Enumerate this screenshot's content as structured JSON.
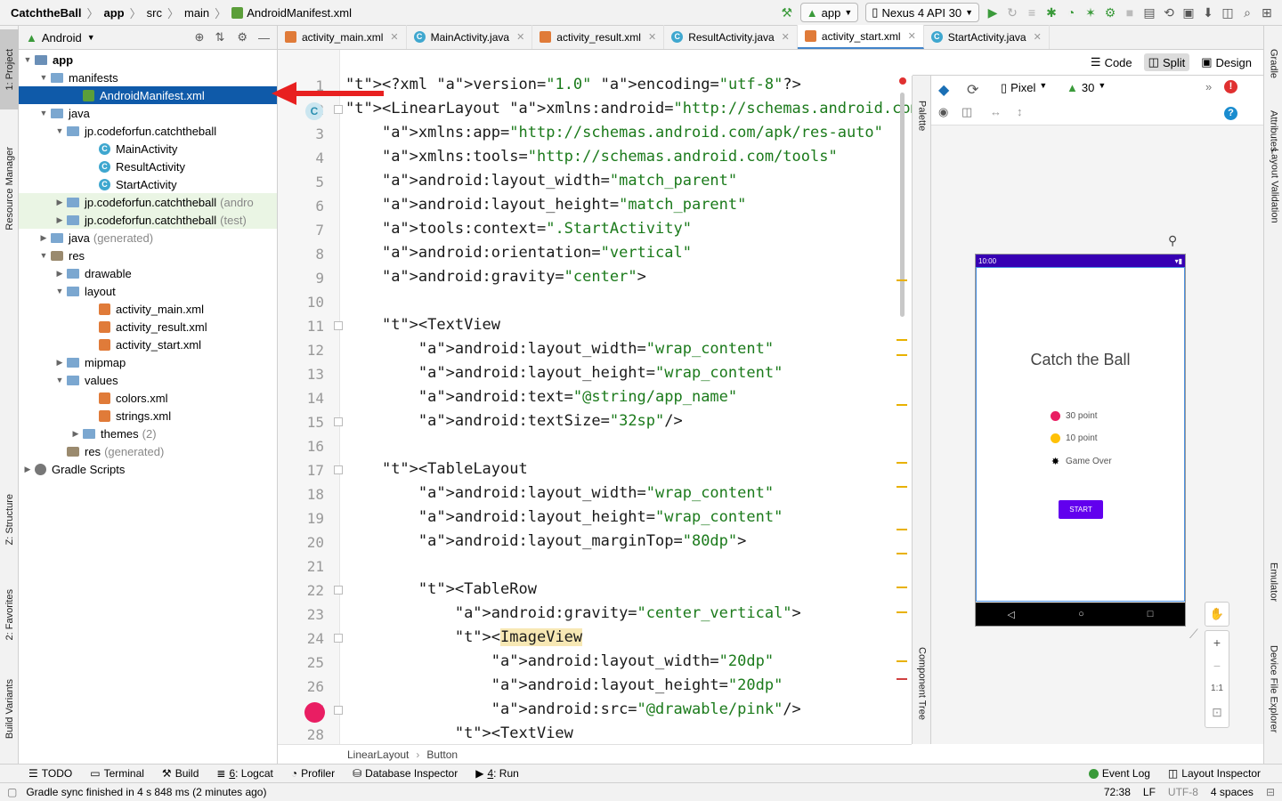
{
  "navbar": {
    "crumbs": [
      "CatchtheBall",
      "app",
      "src",
      "main",
      "AndroidManifest.xml"
    ],
    "run_config": "app",
    "device": "Nexus 4 API 30"
  },
  "left_strip": {
    "project_tab": "1: Project",
    "resource_tab": "Resource Manager",
    "structure_tab": "Z: Structure",
    "favorites_tab": "2: Favorites",
    "variants_tab": "Build Variants"
  },
  "right_strip": {
    "gradle_tab": "Gradle",
    "attributes_tab": "Attributes",
    "validation_tab": "Layout Validation",
    "emulator_tab": "Emulator",
    "device_file_tab": "Device File Explorer"
  },
  "project": {
    "view_label": "Android",
    "tree": [
      {
        "label": "app",
        "extra": "",
        "bold": true
      },
      {
        "label": "manifests",
        "extra": ""
      },
      {
        "label": "AndroidManifest.xml",
        "extra": ""
      },
      {
        "label": "java",
        "extra": ""
      },
      {
        "label": "jp.codeforfun.catchtheball",
        "extra": ""
      },
      {
        "label": "MainActivity",
        "extra": ""
      },
      {
        "label": "ResultActivity",
        "extra": ""
      },
      {
        "label": "StartActivity",
        "extra": ""
      },
      {
        "label": "jp.codeforfun.catchtheball",
        "extra": "(andro"
      },
      {
        "label": "jp.codeforfun.catchtheball",
        "extra": "(test)"
      },
      {
        "label": "java",
        "extra": "(generated)"
      },
      {
        "label": "res",
        "extra": ""
      },
      {
        "label": "drawable",
        "extra": ""
      },
      {
        "label": "layout",
        "extra": ""
      },
      {
        "label": "activity_main.xml",
        "extra": ""
      },
      {
        "label": "activity_result.xml",
        "extra": ""
      },
      {
        "label": "activity_start.xml",
        "extra": ""
      },
      {
        "label": "mipmap",
        "extra": ""
      },
      {
        "label": "values",
        "extra": ""
      },
      {
        "label": "colors.xml",
        "extra": ""
      },
      {
        "label": "strings.xml",
        "extra": ""
      },
      {
        "label": "themes",
        "extra": "(2)"
      },
      {
        "label": "res",
        "extra": "(generated)"
      },
      {
        "label": "Gradle Scripts",
        "extra": ""
      }
    ]
  },
  "tabs": [
    "activity_main.xml",
    "MainActivity.java",
    "activity_result.xml",
    "ResultActivity.java",
    "activity_start.xml",
    "StartActivity.java"
  ],
  "editor": {
    "line_numbers": [
      "1",
      "2",
      "3",
      "4",
      "5",
      "6",
      "7",
      "8",
      "9",
      "10",
      "11",
      "12",
      "13",
      "14",
      "15",
      "16",
      "17",
      "18",
      "19",
      "20",
      "21",
      "22",
      "23",
      "24",
      "25",
      "26",
      "27",
      "28"
    ],
    "lines": [
      "<?xml version=\"1.0\" encoding=\"utf-8\"?>",
      "<LinearLayout xmlns:android=\"http://schemas.android.com/apk/res/",
      "    xmlns:app=\"http://schemas.android.com/apk/res-auto\"",
      "    xmlns:tools=\"http://schemas.android.com/tools\"",
      "    android:layout_width=\"match_parent\"",
      "    android:layout_height=\"match_parent\"",
      "    tools:context=\".StartActivity\"",
      "    android:orientation=\"vertical\"",
      "    android:gravity=\"center\">",
      "",
      "    <TextView",
      "        android:layout_width=\"wrap_content\"",
      "        android:layout_height=\"wrap_content\"",
      "        android:text=\"@string/app_name\"",
      "        android:textSize=\"32sp\"/>",
      "",
      "    <TableLayout",
      "        android:layout_width=\"wrap_content\"",
      "        android:layout_height=\"wrap_content\"",
      "        android:layout_marginTop=\"80dp\">",
      "",
      "        <TableRow",
      "            android:gravity=\"center_vertical\">",
      "            <ImageView",
      "                android:layout_width=\"20dp\"",
      "                android:layout_height=\"20dp\"",
      "                android:src=\"@drawable/pink\"/>",
      "            <TextView"
    ],
    "breadcrumb": [
      "LinearLayout",
      "Button"
    ]
  },
  "design": {
    "modes": [
      "Code",
      "Split",
      "Design"
    ],
    "device": "Pixel",
    "api": "30",
    "palette_label": "Palette",
    "component_tree_label": "Component Tree",
    "zoom_reset": "1:1",
    "preview": {
      "time": "10:00",
      "title": "Catch the Ball",
      "rows": [
        "30 point",
        "10 point",
        "Game Over"
      ],
      "button": "START"
    }
  },
  "bottom_tabs": {
    "todo": "TODO",
    "terminal": "Terminal",
    "build": "Build",
    "logcat_num": "6",
    "logcat": ": Logcat",
    "profiler": "Profiler",
    "database": "Database Inspector",
    "run_num": "4",
    "run": ": Run",
    "event_log": "Event Log",
    "layout_inspector": "Layout Inspector"
  },
  "status": {
    "message": "Gradle sync finished in 4 s 848 ms (2 minutes ago)",
    "position": "72:38",
    "line_sep": "LF",
    "encoding": "UTF-8",
    "indent": "4 spaces"
  },
  "colors": {
    "selection": "#0f5aa9",
    "preview_status_bar": "#3700b3",
    "preview_button": "#6200ee",
    "pink": "#e91e63",
    "yellow": "#ffc107",
    "arrow": "#e82020"
  }
}
